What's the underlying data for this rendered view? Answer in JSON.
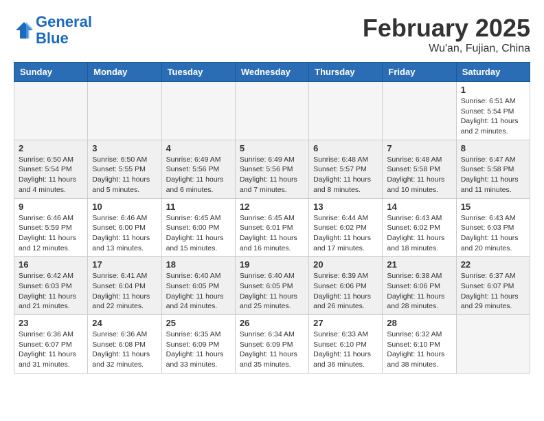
{
  "header": {
    "logo_line1": "General",
    "logo_line2": "Blue",
    "month_title": "February 2025",
    "location": "Wu'an, Fujian, China"
  },
  "days_of_week": [
    "Sunday",
    "Monday",
    "Tuesday",
    "Wednesday",
    "Thursday",
    "Friday",
    "Saturday"
  ],
  "weeks": [
    {
      "shaded": false,
      "days": [
        {
          "num": "",
          "info": ""
        },
        {
          "num": "",
          "info": ""
        },
        {
          "num": "",
          "info": ""
        },
        {
          "num": "",
          "info": ""
        },
        {
          "num": "",
          "info": ""
        },
        {
          "num": "",
          "info": ""
        },
        {
          "num": "1",
          "info": "Sunrise: 6:51 AM\nSunset: 5:54 PM\nDaylight: 11 hours and 2 minutes."
        }
      ]
    },
    {
      "shaded": true,
      "days": [
        {
          "num": "2",
          "info": "Sunrise: 6:50 AM\nSunset: 5:54 PM\nDaylight: 11 hours and 4 minutes."
        },
        {
          "num": "3",
          "info": "Sunrise: 6:50 AM\nSunset: 5:55 PM\nDaylight: 11 hours and 5 minutes."
        },
        {
          "num": "4",
          "info": "Sunrise: 6:49 AM\nSunset: 5:56 PM\nDaylight: 11 hours and 6 minutes."
        },
        {
          "num": "5",
          "info": "Sunrise: 6:49 AM\nSunset: 5:56 PM\nDaylight: 11 hours and 7 minutes."
        },
        {
          "num": "6",
          "info": "Sunrise: 6:48 AM\nSunset: 5:57 PM\nDaylight: 11 hours and 8 minutes."
        },
        {
          "num": "7",
          "info": "Sunrise: 6:48 AM\nSunset: 5:58 PM\nDaylight: 11 hours and 10 minutes."
        },
        {
          "num": "8",
          "info": "Sunrise: 6:47 AM\nSunset: 5:58 PM\nDaylight: 11 hours and 11 minutes."
        }
      ]
    },
    {
      "shaded": false,
      "days": [
        {
          "num": "9",
          "info": "Sunrise: 6:46 AM\nSunset: 5:59 PM\nDaylight: 11 hours and 12 minutes."
        },
        {
          "num": "10",
          "info": "Sunrise: 6:46 AM\nSunset: 6:00 PM\nDaylight: 11 hours and 13 minutes."
        },
        {
          "num": "11",
          "info": "Sunrise: 6:45 AM\nSunset: 6:00 PM\nDaylight: 11 hours and 15 minutes."
        },
        {
          "num": "12",
          "info": "Sunrise: 6:45 AM\nSunset: 6:01 PM\nDaylight: 11 hours and 16 minutes."
        },
        {
          "num": "13",
          "info": "Sunrise: 6:44 AM\nSunset: 6:02 PM\nDaylight: 11 hours and 17 minutes."
        },
        {
          "num": "14",
          "info": "Sunrise: 6:43 AM\nSunset: 6:02 PM\nDaylight: 11 hours and 18 minutes."
        },
        {
          "num": "15",
          "info": "Sunrise: 6:43 AM\nSunset: 6:03 PM\nDaylight: 11 hours and 20 minutes."
        }
      ]
    },
    {
      "shaded": true,
      "days": [
        {
          "num": "16",
          "info": "Sunrise: 6:42 AM\nSunset: 6:03 PM\nDaylight: 11 hours and 21 minutes."
        },
        {
          "num": "17",
          "info": "Sunrise: 6:41 AM\nSunset: 6:04 PM\nDaylight: 11 hours and 22 minutes."
        },
        {
          "num": "18",
          "info": "Sunrise: 6:40 AM\nSunset: 6:05 PM\nDaylight: 11 hours and 24 minutes."
        },
        {
          "num": "19",
          "info": "Sunrise: 6:40 AM\nSunset: 6:05 PM\nDaylight: 11 hours and 25 minutes."
        },
        {
          "num": "20",
          "info": "Sunrise: 6:39 AM\nSunset: 6:06 PM\nDaylight: 11 hours and 26 minutes."
        },
        {
          "num": "21",
          "info": "Sunrise: 6:38 AM\nSunset: 6:06 PM\nDaylight: 11 hours and 28 minutes."
        },
        {
          "num": "22",
          "info": "Sunrise: 6:37 AM\nSunset: 6:07 PM\nDaylight: 11 hours and 29 minutes."
        }
      ]
    },
    {
      "shaded": false,
      "days": [
        {
          "num": "23",
          "info": "Sunrise: 6:36 AM\nSunset: 6:07 PM\nDaylight: 11 hours and 31 minutes."
        },
        {
          "num": "24",
          "info": "Sunrise: 6:36 AM\nSunset: 6:08 PM\nDaylight: 11 hours and 32 minutes."
        },
        {
          "num": "25",
          "info": "Sunrise: 6:35 AM\nSunset: 6:09 PM\nDaylight: 11 hours and 33 minutes."
        },
        {
          "num": "26",
          "info": "Sunrise: 6:34 AM\nSunset: 6:09 PM\nDaylight: 11 hours and 35 minutes."
        },
        {
          "num": "27",
          "info": "Sunrise: 6:33 AM\nSunset: 6:10 PM\nDaylight: 11 hours and 36 minutes."
        },
        {
          "num": "28",
          "info": "Sunrise: 6:32 AM\nSunset: 6:10 PM\nDaylight: 11 hours and 38 minutes."
        },
        {
          "num": "",
          "info": ""
        }
      ]
    }
  ]
}
